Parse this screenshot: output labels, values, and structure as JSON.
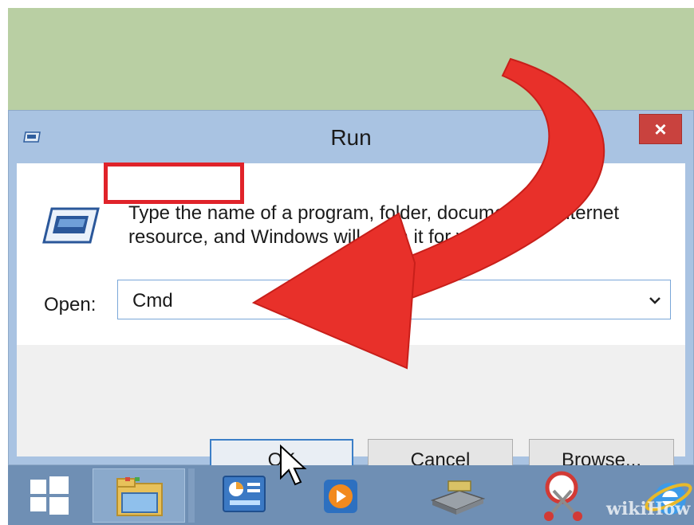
{
  "window": {
    "title": "Run",
    "close_glyph": "×",
    "description_line1": "Type the name of a program, folder, document, or Internet",
    "description_line2": "resource, and Windows will open it for you.",
    "open_label": "Open:",
    "open_value": "Cmd",
    "buttons": {
      "ok": "OK",
      "cancel": "Cancel",
      "browse": "Browse..."
    }
  },
  "taskbar": {
    "icons": [
      "windows-start-icon",
      "file-explorer-icon",
      "control-panel-icon",
      "media-player-icon",
      "drive-icon",
      "snipping-tool-icon",
      "internet-explorer-icon"
    ]
  },
  "watermark": "wikiHow",
  "colors": {
    "title_bar": "#a9c3e2",
    "close_button": "#c9423e",
    "highlight_box": "#e0232a",
    "arrow": "#e8302a",
    "taskbar": "#6f8fb4",
    "desktop": "#b9cfa3"
  }
}
